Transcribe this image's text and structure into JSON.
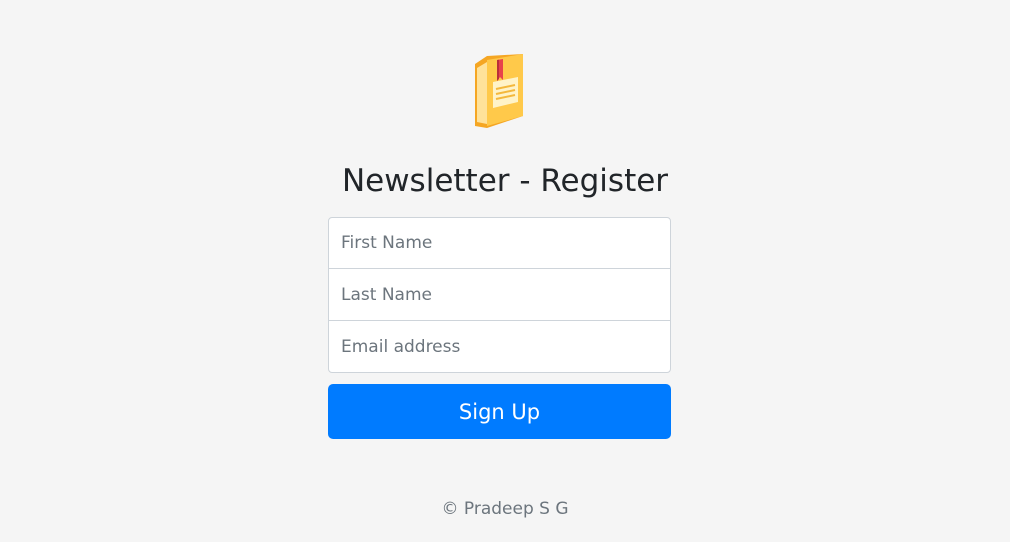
{
  "logo": {
    "icon": "book-icon"
  },
  "page": {
    "title": "Newsletter - Register"
  },
  "form": {
    "first_name": {
      "placeholder": "First Name",
      "value": ""
    },
    "last_name": {
      "placeholder": "Last Name",
      "value": ""
    },
    "email": {
      "placeholder": "Email address",
      "value": ""
    },
    "submit_label": "Sign Up"
  },
  "footer": {
    "text": "© Pradeep S G"
  },
  "colors": {
    "background": "#f5f5f5",
    "accent": "#007bff",
    "title_text": "#212529",
    "muted_text": "#6c757d"
  }
}
